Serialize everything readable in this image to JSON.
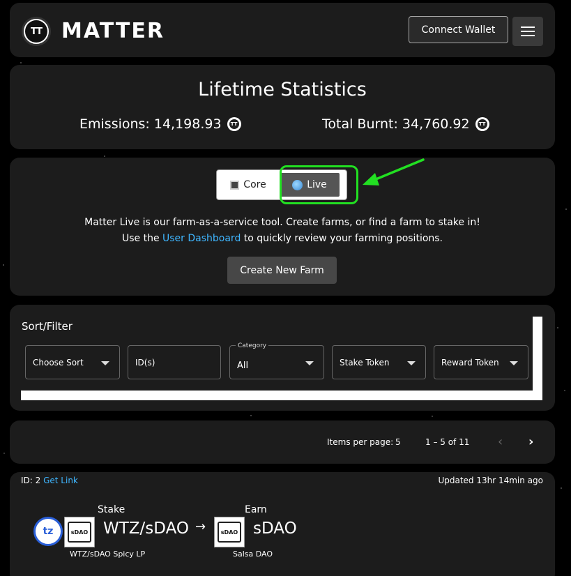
{
  "header": {
    "logo_mark": "TT",
    "logo_text": "MATTER",
    "connect_label": "Connect Wallet"
  },
  "stats": {
    "title": "Lifetime Statistics",
    "emissions": "Emissions: 14,198.93",
    "burnt": "Total Burnt: 34,760.92",
    "token_icon_mark": "TT"
  },
  "live": {
    "core_label": "Core",
    "live_label": "Live",
    "desc_line1": "Matter Live is our farm-as-a-service tool. Create farms, or find a farm to stake in!",
    "desc_line2_pre": "Use the ",
    "desc_line2_link": "User Dashboard",
    "desc_line2_post": " to quickly review your farming positions.",
    "create_label": "Create New Farm",
    "accent_color": "#22e022",
    "link_color": "#3fb6ff"
  },
  "sort_filter": {
    "title": "Sort/Filter",
    "sort_label": "Choose Sort",
    "ids_placeholder": "ID(s)",
    "category_label": "Category",
    "category_value": "All",
    "stake_token_label": "Stake Token",
    "reward_token_label": "Reward Token"
  },
  "pager": {
    "items_per_page_label": "Items per page:",
    "items_per_page_value": "5",
    "range": "1 – 5 of 11",
    "prev_glyph": "‹",
    "next_glyph": "›"
  },
  "farm": {
    "id_label": "ID: 2",
    "get_link_label": "Get Link",
    "updated": "Updated 13hr 14min ago",
    "stake_label": "Stake",
    "earn_label": "Earn",
    "pair_name": "WTZ/sDAO",
    "arrow": "→",
    "earn_name": "sDAO",
    "stake_sub": "WTZ/sDAO Spicy LP",
    "earn_sub": "Salsa DAO",
    "tz_mark": "tz",
    "sdao_mark": "sDAO"
  }
}
